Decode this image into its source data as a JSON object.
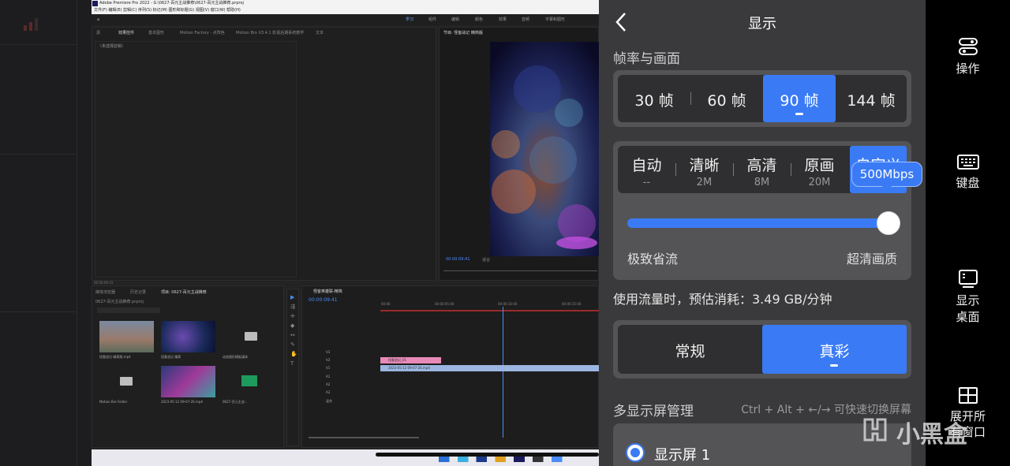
{
  "premiere": {
    "title": "Adobe Premiere Pro 2022 - G:\\0627-百元主战推荐\\0627-百元主战推荐.prproj",
    "menu": "文件(F)  编辑(E)  剪辑(C)  序列(S)  标记(M)  图形和标题(G)  视图(V)  窗口(W)  帮助(H)",
    "workspaces": [
      "学习",
      "组件",
      "编辑",
      "颜色",
      "效果",
      "音频",
      "字幕和图形"
    ],
    "source_tabs": [
      "源",
      "效果控件",
      "基本图形",
      "Motion Factory - 点阵色",
      "Motion Bro X3.4.1 影视后期系统教学",
      "文本"
    ],
    "no_clip_text": "（未选择剪辑）",
    "program_tab": "节目: 怪客战记 精简版",
    "program_timecode": "00:00:09:41",
    "program_fit": "适合",
    "left_timecode": "00:00:09:41",
    "project_tabs": [
      "媒体浏览器",
      "历史记录",
      "项目: 0627-百元主战推荐"
    ],
    "project_file": "0627-百元主战推荐.prproj",
    "bins": [
      {
        "name": "怪客战记-精简版.mp4"
      },
      {
        "name": "怪客战记 精简"
      },
      {
        "name": "动态图形模板媒体"
      },
      {
        "name": "Motion Bro Folder"
      },
      {
        "name": "2023-05-12 09-07-26.mp4"
      },
      {
        "name": "0627-百元主战..."
      }
    ],
    "timeline_tab": "怪客英雄联-精简",
    "timeline_timecode": "00:00:09:41",
    "ruler": [
      "00:00",
      "00:00:05:00",
      "00:00:10:00",
      "00:00:15:00"
    ],
    "tracks": [
      "V3",
      "V2",
      "V1",
      "A1",
      "A2",
      "A3",
      "混合"
    ],
    "clip_pink": "怪客战记_01",
    "clip_blue": "2023-05-12 09-07-26.mp4"
  },
  "panel": {
    "back_label": "<",
    "title": "显示",
    "frame_section": "帧率与画面",
    "fps": [
      {
        "label": "30 帧",
        "selected": false
      },
      {
        "label": "60 帧",
        "selected": false
      },
      {
        "label": "90 帧",
        "selected": true
      },
      {
        "label": "144 帧",
        "selected": false
      }
    ],
    "quality": [
      {
        "label": "自动",
        "sub": "--",
        "selected": false
      },
      {
        "label": "清晰",
        "sub": "2M",
        "selected": false
      },
      {
        "label": "高清",
        "sub": "8M",
        "selected": false
      },
      {
        "label": "原画",
        "sub": "20M",
        "selected": false
      },
      {
        "label": "自定义",
        "sub": "",
        "selected": true
      }
    ],
    "bitrate_tooltip": "500Mbps",
    "slider": {
      "value": 1.0,
      "min_label": "极致省流",
      "max_label": "超清画质"
    },
    "usage_text": "使用流量时，预估消耗：3.49 GB/分钟",
    "color_modes": [
      {
        "label": "常规",
        "selected": false
      },
      {
        "label": "真彩",
        "selected": true
      }
    ],
    "multi_screen_title": "多显示屏管理",
    "multi_screen_hint": "Ctrl + Alt + ←/→ 可快速切换屏幕",
    "screen_1": "显示屏 1"
  },
  "toolbar": {
    "items": [
      {
        "label": "操作",
        "icon": "controller-icon"
      },
      {
        "label": "键盘",
        "icon": "keyboard-icon"
      },
      {
        "label": "显示\n桌面",
        "icon": "desktop-icon"
      },
      {
        "label": "展开所\n有窗口",
        "icon": "windows-grid-icon"
      }
    ]
  },
  "watermark": "小黑盒",
  "colors": {
    "accent": "#3a7bf5",
    "panel_bg": "#3a3a3c",
    "segment_bg": "#2f2f31",
    "section_bg": "#545457"
  }
}
